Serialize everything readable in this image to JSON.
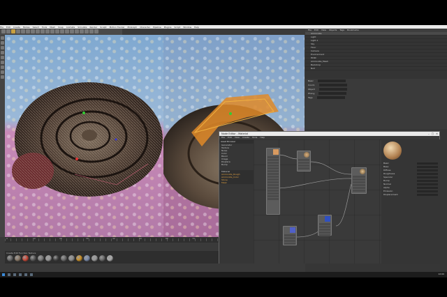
{
  "app": {
    "menu": [
      "File",
      "Edit",
      "Create",
      "Modes",
      "Select",
      "Tools",
      "Mesh",
      "Snap",
      "Animate",
      "Simulate",
      "Render",
      "Sculpt",
      "Motion Tracker",
      "MoGraph",
      "Character",
      "Pipeline",
      "Plugins",
      "Script",
      "Window",
      "Help"
    ]
  },
  "object_manager": {
    "tabs": [
      "File",
      "Edit",
      "View",
      "Objects",
      "Tags",
      "Bookmarks"
    ],
    "rows": [
      "Ammonite",
      "Light",
      "Light.1",
      "Sky",
      "Floor",
      "Camera",
      "Environment",
      "HDRI",
      "Ammonite_Mesh",
      "Backdrop",
      "Null"
    ]
  },
  "attributes": {
    "rows": [
      "Basic",
      "Coord.",
      "Object",
      "Phong",
      "Tags"
    ]
  },
  "timeline": {
    "frames": [
      "0",
      "10",
      "20",
      "30",
      "40",
      "50",
      "60",
      "70",
      "80",
      "90"
    ],
    "end_frame": "90 F"
  },
  "materials": {
    "label": "Create  Edit  Function  Texture",
    "swatch_colors": [
      "#6a6a6a",
      "#8a7a6a",
      "#c84a3a",
      "#5a5a5a",
      "#7a7a7a",
      "#999999",
      "#444444",
      "#6a6a6a",
      "#8a8a8a",
      "#c8902a",
      "#7a8aa8",
      "#9a9a9a",
      "#6a6a6a",
      "#aaaaaa"
    ]
  },
  "coords": {
    "rows": [
      "Position",
      "X 0 cm",
      "Y 0 cm",
      "Z 0 cm",
      "Size",
      "Rotation",
      "Apply"
    ]
  },
  "node_editor": {
    "title": "Node Editor - Material",
    "menu": [
      "File",
      "Edit",
      "View",
      "Create",
      "Tools",
      "Help"
    ],
    "left_header": "Asset Browser",
    "left_items": [
      "Generator",
      "Texture",
      "Noise",
      "Color",
      "Blend",
      "Image",
      "Displace",
      "Bump"
    ],
    "left_items2": [
      "Material",
      "Ammonite_Rough",
      "Ammonite_Color",
      "Stone",
      "Mask"
    ],
    "nodes": [
      {
        "title": "Texture",
        "preview_color": "#d89a60",
        "ports": 16
      },
      {
        "title": "Color",
        "preview_color": "#c8a070",
        "ports": 4
      },
      {
        "title": "Material",
        "preview_color": "#c8a070",
        "ports": 6
      },
      {
        "title": "Normal",
        "preview_color": "#5060c8",
        "ports": 4
      },
      {
        "title": "Noise",
        "preview_color": "#3050c0",
        "ports": 5
      }
    ],
    "props": [
      "Basic",
      "Base",
      "Diffuse",
      "Roughness",
      "Specular",
      "Bump",
      "Normal",
      "Alpha",
      "Emission",
      "Displacement"
    ]
  },
  "taskbar": {
    "clock": "12:00"
  }
}
